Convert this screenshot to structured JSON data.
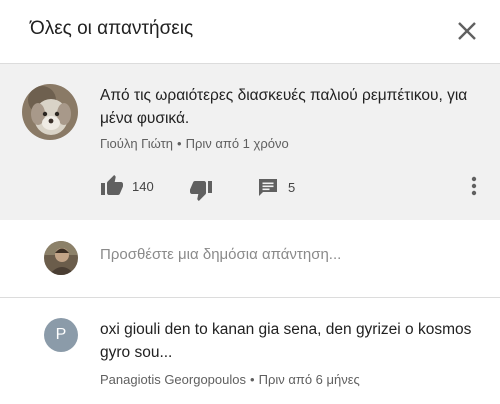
{
  "header": {
    "title": "Όλες οι απαντήσεις",
    "close_icon": "close-icon"
  },
  "comment": {
    "text": "Από τις ωραιότερες διασκευές παλιού ρεμπέτικου, για μένα φυσικά.",
    "author": "Γιούλη Γιώτη",
    "separator": "•",
    "time": "Πριν από 1 χρόνο",
    "likes": "140",
    "replies": "5",
    "icons": [
      "thumb-up-icon",
      "thumb-down-icon",
      "comment-icon",
      "more-vertical-icon"
    ]
  },
  "reply_box": {
    "placeholder": "Προσθέστε μια δημόσια απάντηση..."
  },
  "reply": {
    "avatar_letter": "P",
    "text": "oxi giouli den to kanan gia sena, den gyrizei o kosmos gyro sou...",
    "author": "Panagiotis Georgopoulos",
    "separator": "•",
    "time": "Πριν από 6 μήνες"
  },
  "colors": {
    "comment_background": "#f1f1f1",
    "letter_avatar": "#8b9ba9",
    "meta_text": "#606060"
  }
}
